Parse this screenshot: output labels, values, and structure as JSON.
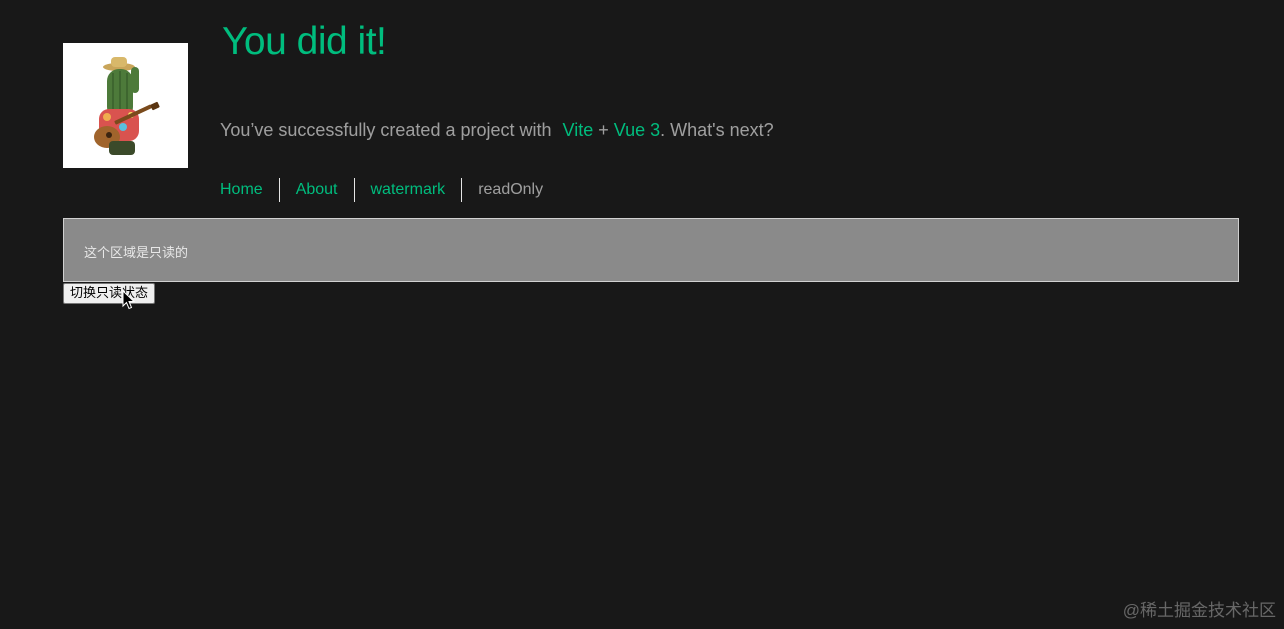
{
  "header": {
    "title": "You did it!",
    "subtitle_prefix": "You’ve successfully created a project with",
    "link_vite": "Vite",
    "plus": "+",
    "link_vue": "Vue 3",
    "subtitle_suffix": ". What's next?"
  },
  "logo": {
    "icon": "cactus-guitar-logo"
  },
  "nav": {
    "items": [
      {
        "label": "Home"
      },
      {
        "label": "About"
      },
      {
        "label": "watermark"
      },
      {
        "label": "readOnly"
      }
    ],
    "active": "readOnly"
  },
  "readonly": {
    "text": "这个区域是只读的",
    "button_label": "切换只读状态"
  },
  "watermark": {
    "text": "@稀土掘金技术社区"
  },
  "colors": {
    "background": "#181818",
    "accent": "#00bd7e",
    "text": "#ebebeba3",
    "readonly_bg": "#8a8a8a"
  }
}
